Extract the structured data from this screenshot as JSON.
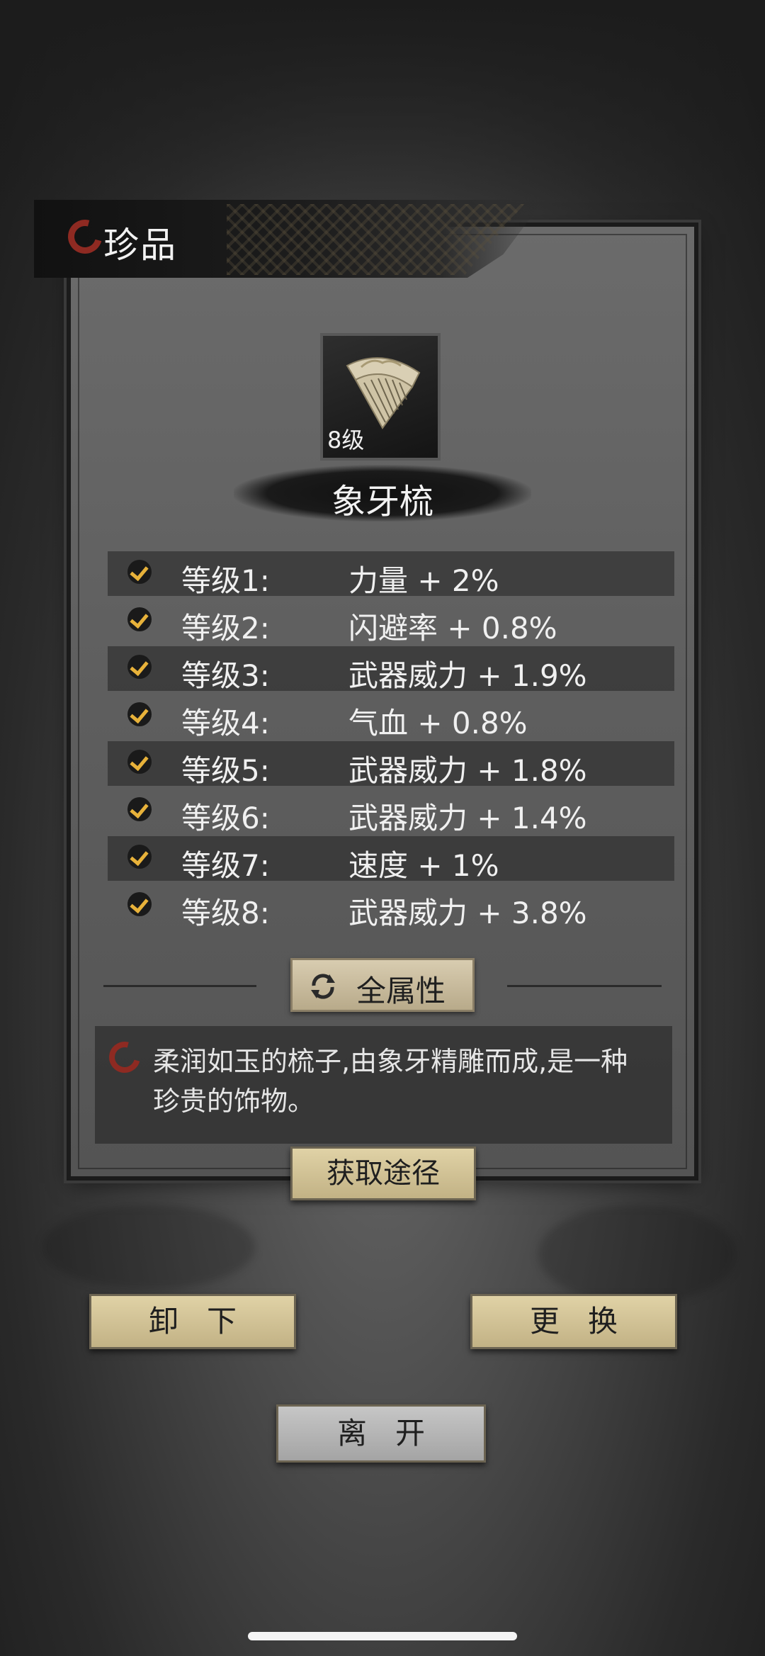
{
  "header": {
    "title": "珍品"
  },
  "item": {
    "level_badge": "8级",
    "name": "象牙梳",
    "icon": "ivory-comb-icon"
  },
  "stats": [
    {
      "level": "等级1:",
      "value": "力量 + 2%"
    },
    {
      "level": "等级2:",
      "value": "闪避率 + 0.8%"
    },
    {
      "level": "等级3:",
      "value": "武器威力 + 1.9%"
    },
    {
      "level": "等级4:",
      "value": "气血 + 0.8%"
    },
    {
      "level": "等级5:",
      "value": "武器威力 + 1.8%"
    },
    {
      "level": "等级6:",
      "value": "武器威力 + 1.4%"
    },
    {
      "level": "等级7:",
      "value": "速度 + 1%"
    },
    {
      "level": "等级8:",
      "value": "武器威力 + 3.8%"
    }
  ],
  "buttons": {
    "all_attributes": "全属性",
    "source": "获取途径",
    "unequip": "卸下",
    "replace": "更换",
    "leave": "离开"
  },
  "description": "柔润如玉的梳子,由象牙精雕而成,是一种珍贵的饰物。",
  "colors": {
    "check_gold": "#e8b23a",
    "logo_red": "#8e2a22",
    "button_gold": "#d8ccb0"
  }
}
